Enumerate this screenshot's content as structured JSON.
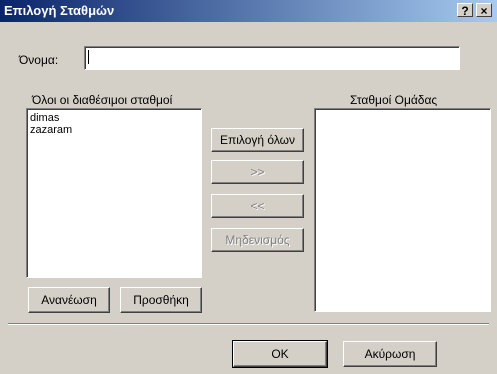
{
  "window": {
    "title": "Επιλογή Σταθμών",
    "help_label": "?",
    "close_label": "×"
  },
  "name_field": {
    "label": "Όνομα:",
    "value": ""
  },
  "available": {
    "label": "Όλοι οι διαθέσιμοι σταθμοί",
    "items": [
      "dimas",
      "zazaram"
    ]
  },
  "group": {
    "label": "Σταθμοί Ομάδας",
    "items": []
  },
  "buttons": {
    "select_all": "Επιλογή όλων",
    "add_right": ">>",
    "remove_left": "<<",
    "reset": "Μηδενισμός",
    "refresh": "Ανανέωση",
    "add": "Προσθήκη",
    "ok": "OK",
    "cancel": "Ακύρωση"
  }
}
